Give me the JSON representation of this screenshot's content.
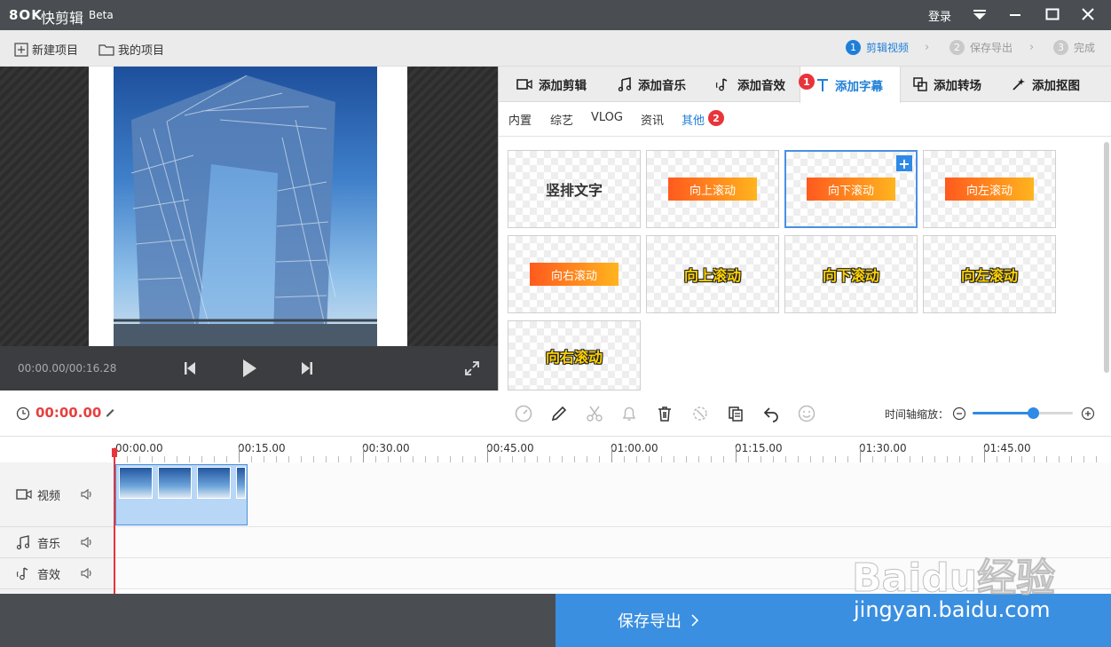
{
  "app": {
    "logo": "8OK",
    "name": "快剪辑",
    "beta": "Beta",
    "login": "登录"
  },
  "toolbar": {
    "new_project": "新建项目",
    "my_projects": "我的项目"
  },
  "steps": [
    {
      "num": "1",
      "label": "剪辑视频"
    },
    {
      "num": "2",
      "label": "保存导出"
    },
    {
      "num": "3",
      "label": "完成"
    }
  ],
  "player": {
    "timecode": "00:00.00/00:16.28"
  },
  "tabs": [
    {
      "label": "添加剪辑",
      "icon": "video-camera-icon"
    },
    {
      "label": "添加音乐",
      "icon": "music-note-icon"
    },
    {
      "label": "添加音效",
      "icon": "sound-effect-icon"
    },
    {
      "label": "添加字幕",
      "icon": "text-t-icon",
      "badge": "1"
    },
    {
      "label": "添加转场",
      "icon": "transition-icon"
    },
    {
      "label": "添加抠图",
      "icon": "magic-wand-icon"
    }
  ],
  "subtabs": [
    {
      "label": "内置"
    },
    {
      "label": "综艺"
    },
    {
      "label": "VLOG"
    },
    {
      "label": "资讯"
    },
    {
      "label": "其他",
      "badge": "2"
    }
  ],
  "cards": [
    {
      "text": "竖排文字",
      "style": "plain"
    },
    {
      "text": "向上滚动",
      "style": "pill"
    },
    {
      "text": "向下滚动",
      "style": "pill",
      "add": "+"
    },
    {
      "text": "向左滚动",
      "style": "pill"
    },
    {
      "text": "向右滚动",
      "style": "pill"
    },
    {
      "text": "向上滚动",
      "style": "yellow"
    },
    {
      "text": "向下滚动",
      "style": "yellow"
    },
    {
      "text": "向左滚动",
      "style": "yellow"
    },
    {
      "text": "向右滚动",
      "style": "yellow"
    }
  ],
  "timeline": {
    "current_time": "00:00.00",
    "zoom_label": "时间轴缩放：",
    "zoom_level": 0.6,
    "ruler": [
      "00:00.00",
      "00:15.00",
      "00:30.00",
      "00:45.00",
      "01:00.00",
      "01:15.00",
      "01:30.00",
      "01:45.00"
    ],
    "tracks": [
      {
        "label": "视频",
        "icon": "video-camera-icon"
      },
      {
        "label": "音乐",
        "icon": "music-note-icon"
      },
      {
        "label": "音效",
        "icon": "sound-effect-icon"
      }
    ]
  },
  "export_button": "保存导出",
  "watermark": {
    "brand": "Baidu经验",
    "url": "jingyan.baidu.com"
  },
  "colors": {
    "accent": "#2e8ae6",
    "badge": "#e8343a",
    "time_red": "#e84040"
  }
}
